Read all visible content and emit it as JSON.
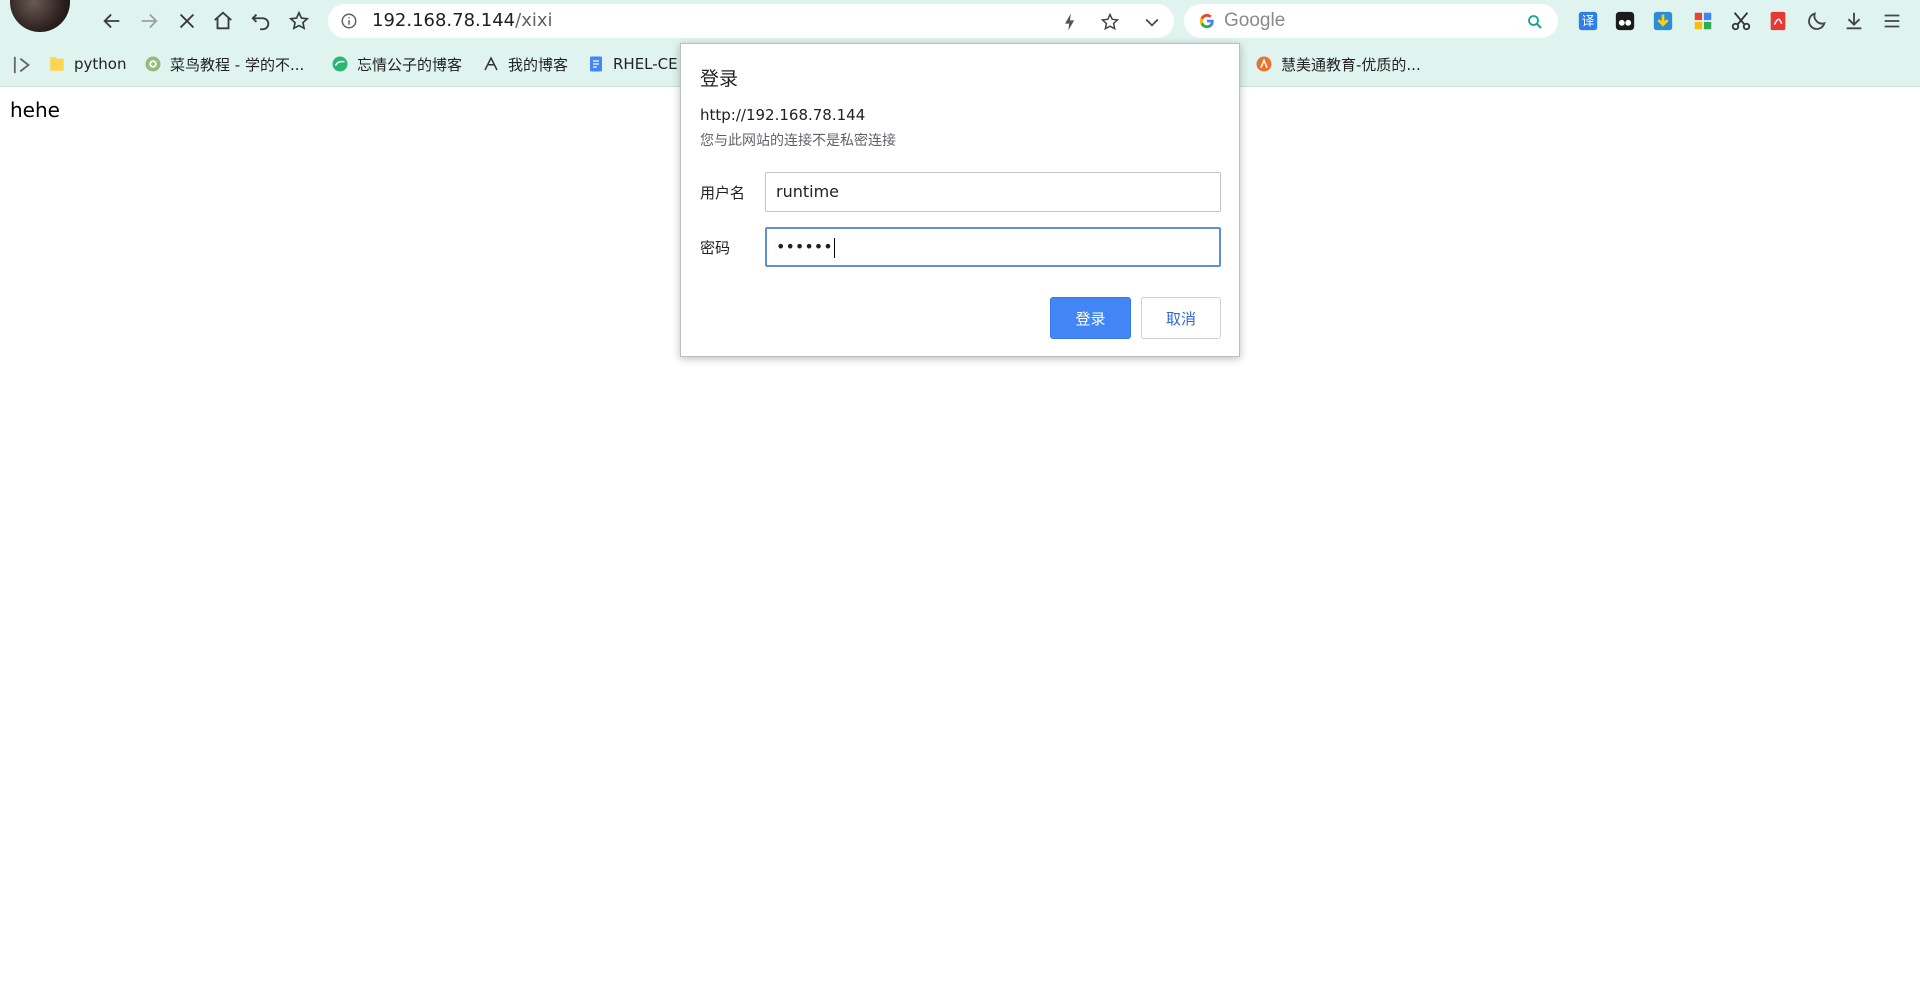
{
  "browser": {
    "url_host": "192.168.78.144",
    "url_path": "/xixi",
    "search_placeholder": "Google"
  },
  "bookmarks": [
    {
      "label": "python",
      "icon": "folder-icon"
    },
    {
      "label": "菜鸟教程 - 学的不...",
      "icon": "runoob-icon"
    },
    {
      "label": "忘情公子的博客",
      "icon": "blog-icon"
    },
    {
      "label": "我的博客",
      "icon": "blog-icon"
    },
    {
      "label": "RHEL-CE",
      "icon": "doc-icon"
    },
    {
      "label": "慧美通教育-优质的...",
      "icon": "edu-icon"
    }
  ],
  "page": {
    "body_text": "hehe"
  },
  "dialog": {
    "title": "登录",
    "origin": "http://192.168.78.144",
    "warning": "您与此网站的连接不是私密连接",
    "username_label": "用户名",
    "username_value": "runtime",
    "password_label": "密码",
    "password_value": "••••••",
    "login_button": "登录",
    "cancel_button": "取消"
  },
  "colors": {
    "toolbar_bg": "#dff4ee",
    "primary_button": "#4285f4",
    "focus_border": "#5b8fd9"
  }
}
